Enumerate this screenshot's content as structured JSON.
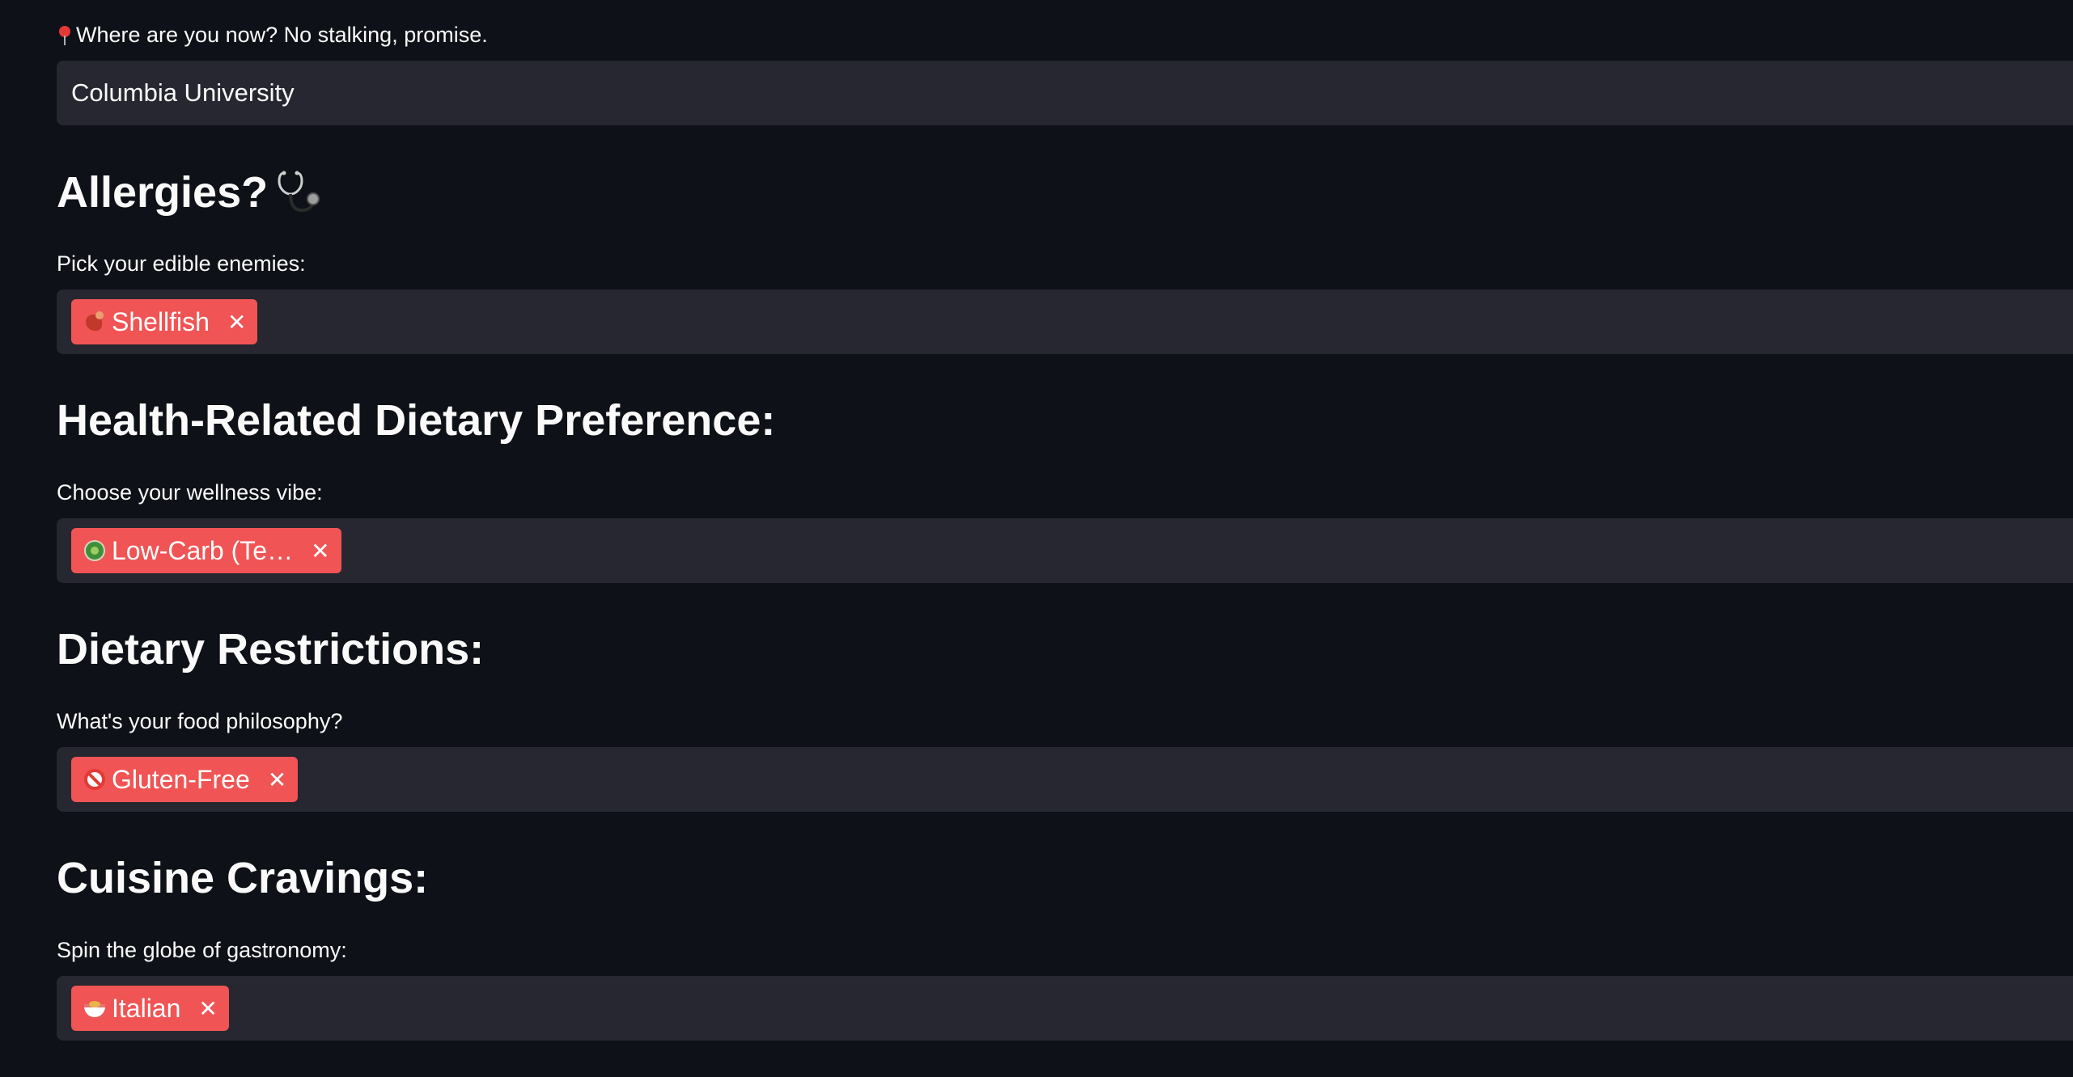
{
  "location": {
    "label": "Where are you now? No stalking, promise.",
    "label_icon": "round-pushpin-icon",
    "value": "Columbia University"
  },
  "allergies": {
    "heading": "Allergies?",
    "heading_icon": "stethoscope-icon",
    "label": "Pick your edible enemies:",
    "selected": [
      {
        "emoji": "lobster-icon",
        "label": "Shellfish"
      }
    ]
  },
  "health": {
    "heading": "Health-Related Dietary Preference:",
    "label": "Choose your wellness vibe:",
    "selected": [
      {
        "emoji": "salad-icon",
        "label": "Low-Carb (Te…"
      }
    ]
  },
  "restrictions": {
    "heading": "Dietary Restrictions:",
    "label": "What's your food philosophy?",
    "selected": [
      {
        "emoji": "prohibited-icon",
        "label": "Gluten-Free"
      }
    ]
  },
  "cuisine": {
    "heading": "Cuisine Cravings:",
    "label": "Spin the globe of gastronomy:",
    "selected": [
      {
        "emoji": "spaghetti-icon",
        "label": "Italian"
      }
    ]
  },
  "tag_remove_glyph": "✕",
  "colors": {
    "background": "#0e1117",
    "input_bg": "#262730",
    "tag_bg": "#f05454",
    "text": "#fafafa"
  }
}
